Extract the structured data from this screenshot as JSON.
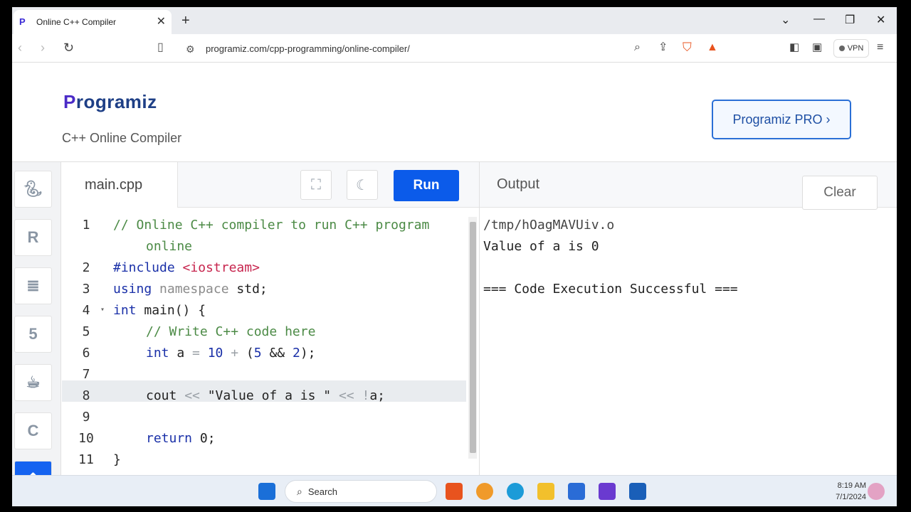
{
  "browser": {
    "tab_title": "Online C++ Compiler",
    "url": "programiz.com/cpp-programming/online-compiler/",
    "vpn_label": "VPN"
  },
  "header": {
    "logo_text": "rogramiz",
    "logo_initial": "P",
    "subtitle": "C++ Online Compiler",
    "pro_button": "Programiz PRO ›"
  },
  "sidebar": {
    "items": [
      "python",
      "r",
      "sql",
      "html",
      "java",
      "c"
    ]
  },
  "editor": {
    "filename": "main.cpp",
    "run_label": "Run",
    "line_numbers": [
      "1",
      "2",
      "3",
      "4",
      "5",
      "6",
      "7",
      "8",
      "9",
      "10",
      "11"
    ],
    "active_line": 8
  },
  "code": {
    "l1a": "// Online C++ compiler to run C++ program",
    "l1b": "online",
    "l2_kw": "#include",
    "l2_str": "<iostream>",
    "l3_kw": "using",
    "l3_ns": "namespace",
    "l3_rest": " std;",
    "l4_kw": "int",
    "l4_rest": " main() {",
    "l5": "// Write C++ code here",
    "l6_kw": "int",
    "l6_a": " a ",
    "l6_op1": "=",
    "l6_num1": " 10 ",
    "l6_op2": "+",
    "l6_paren": " (",
    "l6_num2": "5",
    "l6_and": " && ",
    "l6_num3": "2",
    "l6_end": ");",
    "l8_cout": "cout ",
    "l8_op1": "<<",
    "l8_str": " \"Value of a is \" ",
    "l8_op2": "<<",
    "l8_bang": " !",
    "l8_end": "a;",
    "l10_kw": "return",
    "l10_rest": " 0;",
    "l11": "}"
  },
  "output": {
    "label": "Output",
    "clear_label": "Clear",
    "lines": [
      "/tmp/hOagMAVUiv.o",
      "Value of a is 0",
      "",
      "=== Code Execution Successful ==="
    ]
  },
  "taskbar": {
    "search_placeholder": "Search",
    "time": "8:19 AM",
    "date": "7/1/2024"
  }
}
